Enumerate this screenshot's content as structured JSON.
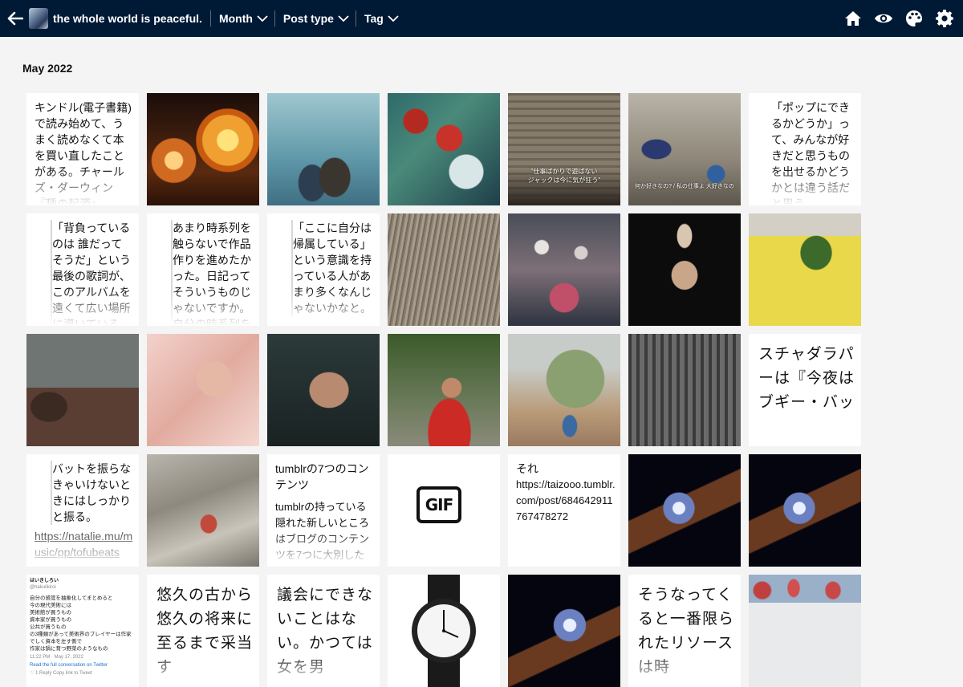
{
  "header": {
    "blog_title": "the whole world is peaceful.",
    "filters": [
      {
        "label": "Month"
      },
      {
        "label": "Post type"
      },
      {
        "label": "Tag"
      }
    ]
  },
  "section": {
    "month_heading": "May 2022"
  },
  "posts": {
    "r1c1": "キンドル(電子書籍)で読み始めて、うまく読めなくて本を買い直したことがある。チャールズ・ダーウィン『種の起源』",
    "r1c5_caption_line1": "\"仕事ばかりで遊ばない",
    "r1c5_caption_line2": "ジャックは今に気が狂う\"",
    "r1c6_caption": "何か好きなの? / 私の仕事よ 大好きなの",
    "r1c7": "「ポップにできるかどうか」って、みんなが好きだと思うものを出せるかどうかとは違う話だと思う",
    "r2c1": "「背負っているのは 誰だってそうだ」という最後の歌詞が、このアルバムを遠くて広い場所に導いている",
    "r2c2": "あまり時系列を触らないで作品作りを進めたかった。日記ってそういうものじゃないですか。自分の時系列を",
    "r2c3": "「ここに自分は帰属している」という意識を持っている人があまり多くなんじゃないかなと。",
    "r3c7": "スチャダラパーは『今夜はブギー・バッ",
    "r4c1_quote": "バットを振らなきゃいけないときにはしっかりと振る。",
    "r4c1_link": "https://natalie.mu/music/pp/tofubeats",
    "r4c3_title": "tumblrの7つのコンテンツ",
    "r4c3_body": "tumblrの持っている隠れた新しいところはブログのコンテンツを7つに大別した",
    "r4c4_badge": "GIF",
    "r4c5_line1": "それ",
    "r4c5_line2": "https://taizooo.tumblr.com/post/684642911767478272",
    "r5c1_name": "はいきしろい",
    "r5c1_handle": "@hakuiikiroi",
    "r5c1_body": "自分の感覚を抽象化してまとめると\n今の現代美術には\n美術館が買うもの\n資本家が買うもの\n公共が買うもの\nの3種類があって美術界のプレイヤーは作家でしく資本を左す側で\n作家は鍋に育つ野菜のようなもの",
    "r5c1_time": "11:22 PM · May 17, 2022",
    "r5c1_read": "Read the full conversation on Twitter",
    "r5c1_actions": "♡ 1  Reply  Copy link to Tweet",
    "r5c2": "悠久の古から悠久の将来に至るまで采当す",
    "r5c3": "議会にできないことはない。かつては女を男",
    "r5c6": "そうなってくると一番限られたリソースは時"
  },
  "colors": {
    "header_bg": "#001935",
    "page_bg": "#f4f4f4"
  },
  "icons": [
    "back-arrow-icon",
    "chevron-down-icon",
    "home-icon",
    "eye-icon",
    "palette-icon",
    "gear-icon"
  ]
}
